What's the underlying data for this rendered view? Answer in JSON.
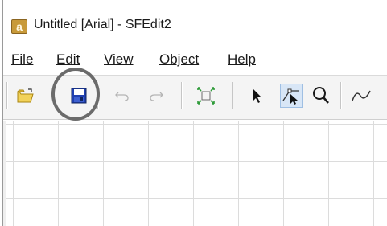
{
  "window": {
    "title": "Untitled [Arial] - SFEdit2",
    "app_icon_glyph": "a"
  },
  "menubar": {
    "items": [
      {
        "label": "File"
      },
      {
        "label": "Edit"
      },
      {
        "label": "View"
      },
      {
        "label": "Object"
      },
      {
        "label": "Help"
      }
    ]
  },
  "toolbar": {
    "buttons": [
      {
        "name": "open",
        "icon": "open-folder-icon"
      },
      {
        "name": "save",
        "icon": "save-disk-icon",
        "highlighted": true
      },
      {
        "name": "undo",
        "icon": "undo-icon",
        "enabled": false
      },
      {
        "name": "redo",
        "icon": "redo-icon",
        "enabled": false
      },
      {
        "name": "fit",
        "icon": "fit-to-window-icon"
      },
      {
        "name": "select",
        "icon": "arrow-pointer-icon"
      },
      {
        "name": "node-select",
        "icon": "node-select-icon",
        "active": true
      },
      {
        "name": "zoom",
        "icon": "magnifier-icon"
      },
      {
        "name": "curve",
        "icon": "curve-tool-icon"
      }
    ]
  },
  "colors": {
    "toolbar_bg": "#f4f4f4",
    "grid_line": "#dcdcdc",
    "highlight_ring": "#6b6b6b",
    "pressed_bg": "#d8e6f6"
  }
}
